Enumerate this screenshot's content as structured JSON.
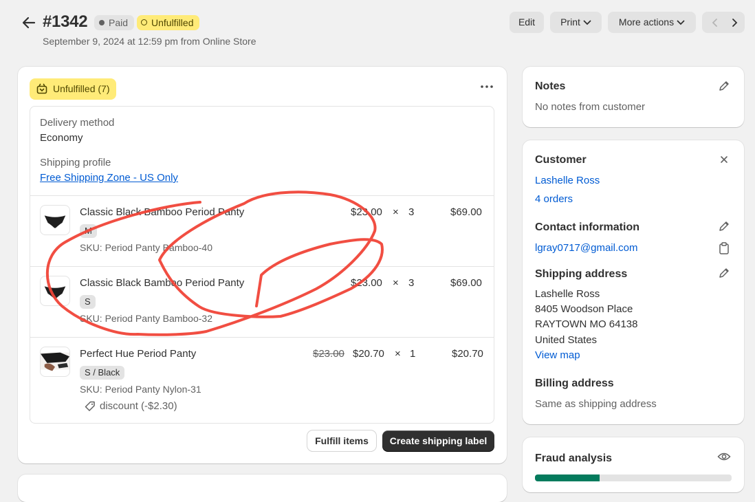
{
  "header": {
    "order_number": "#1342",
    "paid_badge": "Paid",
    "fulfillment_badge": "Unfulfilled",
    "subtitle": "September 9, 2024 at 12:59 pm from Online Store",
    "edit_label": "Edit",
    "print_label": "Print",
    "more_actions_label": "More actions"
  },
  "fulfillment": {
    "badge_label": "Unfulfilled (7)",
    "delivery_method_label": "Delivery method",
    "delivery_method_value": "Economy",
    "shipping_profile_label": "Shipping profile",
    "shipping_profile_link": "Free Shipping Zone - US Only",
    "items": [
      {
        "name": "Classic Black Bamboo Period Panty",
        "variant": "M",
        "sku": "SKU: Period Panty Bamboo-40",
        "original_price": "",
        "price": "$23.00",
        "times": "×",
        "qty": "3",
        "total": "$69.00",
        "discount": ""
      },
      {
        "name": "Classic Black Bamboo Period Panty",
        "variant": "S",
        "sku": "SKU: Period Panty Bamboo-32",
        "original_price": "",
        "price": "$23.00",
        "times": "×",
        "qty": "3",
        "total": "$69.00",
        "discount": ""
      },
      {
        "name": "Perfect Hue Period Panty",
        "variant": "S / Black",
        "sku": "SKU: Period Panty Nylon-31",
        "original_price": "$23.00",
        "price": "$20.70",
        "times": "×",
        "qty": "1",
        "total": "$20.70",
        "discount": "discount (-$2.30)"
      }
    ],
    "fulfill_items_label": "Fulfill items",
    "create_label_label": "Create shipping label"
  },
  "notes": {
    "title": "Notes",
    "text": "No notes from customer"
  },
  "customer": {
    "title": "Customer",
    "name": "Lashelle Ross",
    "orders": "4 orders",
    "contact_title": "Contact information",
    "email": "lgray0717@gmail.com",
    "shipping_title": "Shipping address",
    "address_lines": [
      "Lashelle Ross",
      "8405 Woodson Place",
      "RAYTOWN MO 64138",
      "United States"
    ],
    "view_map": "View map",
    "billing_title": "Billing address",
    "billing_text": "Same as shipping address"
  },
  "fraud": {
    "title": "Fraud analysis",
    "risk_level_fraction": 0.33
  },
  "colors": {
    "accent_link": "#005bd3",
    "unfulfilled_bg": "#ffeb78",
    "annotation_red": "#f04438",
    "fraud_bar": "#047b5d"
  },
  "icons": [
    "back-arrow-icon",
    "chevron-down-icon",
    "chevron-left-icon",
    "chevron-right-icon",
    "ellipsis-icon",
    "pencil-icon",
    "close-icon",
    "clipboard-icon",
    "eye-icon",
    "tag-icon",
    "package-icon"
  ]
}
